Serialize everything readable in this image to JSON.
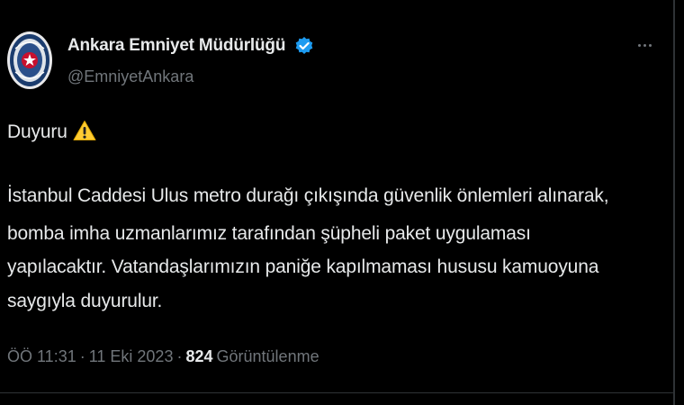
{
  "tweet": {
    "author": {
      "display_name": "Ankara Emniyet Müdürlüğü",
      "handle": "@EmniyetAnkara",
      "verified": true,
      "avatar_icon": "police-badge-icon"
    },
    "more_icon": "more-options-icon",
    "title_line": "Duyuru",
    "title_emoji": "warning-icon",
    "body_lines": [
      "İstanbul Caddesi Ulus metro durağı çıkışında güvenlik önlemleri alınarak,",
      "bomba imha uzmanlarımız tarafından şüpheli paket uygulaması",
      "yapılacaktır. Vatandaşlarımızın paniğe kapılmaması hususu kamuoyuna",
      "saygıyla duyurulur."
    ],
    "meta": {
      "time": "ÖÖ 11:31",
      "separator": "·",
      "date": "11 Eki 2023",
      "views_count": "824",
      "views_label": "Görüntülenme"
    }
  },
  "colors": {
    "background": "#000000",
    "text": "#e7e9ea",
    "secondary": "#71767b",
    "verified_badge": "#1d9bf0",
    "warning": "#ffcc33",
    "divider": "#2f3336"
  }
}
